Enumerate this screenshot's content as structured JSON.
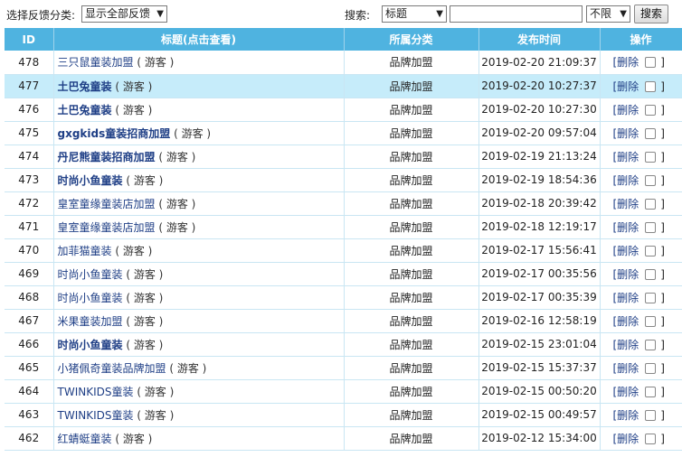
{
  "filter": {
    "label": "选择反馈分类:",
    "value": "显示全部反馈"
  },
  "search": {
    "label": "搜索:",
    "field": "标题",
    "scope": "不限",
    "query": "",
    "button": "搜索"
  },
  "columns": [
    "ID",
    "标题(点击查看)",
    "所属分类",
    "发布时间",
    "操作"
  ],
  "rows": [
    {
      "id": "478",
      "title": "三只鼠童装加盟",
      "guest": "( 游客 )",
      "category": "品牌加盟",
      "time": "2019-02-20 21:09:37",
      "bold": false
    },
    {
      "id": "477",
      "title": "土巴兔童装",
      "guest": "( 游客 )",
      "category": "品牌加盟",
      "time": "2019-02-20 10:27:37",
      "bold": true
    },
    {
      "id": "476",
      "title": "土巴兔童装",
      "guest": "( 游客 )",
      "category": "品牌加盟",
      "time": "2019-02-20 10:27:30",
      "bold": true
    },
    {
      "id": "475",
      "title": "gxgkids童装招商加盟",
      "guest": "( 游客 )",
      "category": "品牌加盟",
      "time": "2019-02-20 09:57:04",
      "bold": true
    },
    {
      "id": "474",
      "title": "丹尼熊童装招商加盟",
      "guest": "( 游客 )",
      "category": "品牌加盟",
      "time": "2019-02-19 21:13:24",
      "bold": true
    },
    {
      "id": "473",
      "title": "时尚小鱼童装",
      "guest": "( 游客 )",
      "category": "品牌加盟",
      "time": "2019-02-19 18:54:36",
      "bold": true
    },
    {
      "id": "472",
      "title": "皇室童缘童装店加盟",
      "guest": "( 游客 )",
      "category": "品牌加盟",
      "time": "2019-02-18 20:39:42",
      "bold": false
    },
    {
      "id": "471",
      "title": "皇室童缘童装店加盟",
      "guest": "( 游客 )",
      "category": "品牌加盟",
      "time": "2019-02-18 12:19:17",
      "bold": false
    },
    {
      "id": "470",
      "title": "加菲猫童装",
      "guest": "( 游客 )",
      "category": "品牌加盟",
      "time": "2019-02-17 15:56:41",
      "bold": false
    },
    {
      "id": "469",
      "title": "时尚小鱼童装",
      "guest": "( 游客 )",
      "category": "品牌加盟",
      "time": "2019-02-17 00:35:56",
      "bold": false
    },
    {
      "id": "468",
      "title": "时尚小鱼童装",
      "guest": "( 游客 )",
      "category": "品牌加盟",
      "time": "2019-02-17 00:35:39",
      "bold": false
    },
    {
      "id": "467",
      "title": "米果童装加盟",
      "guest": "( 游客 )",
      "category": "品牌加盟",
      "time": "2019-02-16 12:58:19",
      "bold": false
    },
    {
      "id": "466",
      "title": "时尚小鱼童装",
      "guest": "( 游客 )",
      "category": "品牌加盟",
      "time": "2019-02-15 23:01:04",
      "bold": true
    },
    {
      "id": "465",
      "title": "小猪佩奇童装品牌加盟",
      "guest": "( 游客 )",
      "category": "品牌加盟",
      "time": "2019-02-15 15:37:37",
      "bold": false
    },
    {
      "id": "464",
      "title": "TWINKIDS童装",
      "guest": "( 游客 )",
      "category": "品牌加盟",
      "time": "2019-02-15 00:50:20",
      "bold": false
    },
    {
      "id": "463",
      "title": "TWINKIDS童装",
      "guest": "( 游客 )",
      "category": "品牌加盟",
      "time": "2019-02-15 00:49:57",
      "bold": false
    },
    {
      "id": "462",
      "title": "红蜻蜓童装",
      "guest": "( 游客 )",
      "category": "品牌加盟",
      "time": "2019-02-12 15:34:00",
      "bold": false
    }
  ],
  "row_actions": {
    "delete_open": "[删除",
    "close": "]"
  },
  "highlight_row": "477",
  "colors": {
    "header_bg": "#4fb3e0",
    "highlight_bg": "#c6ecfa",
    "link": "#1f3f86"
  }
}
